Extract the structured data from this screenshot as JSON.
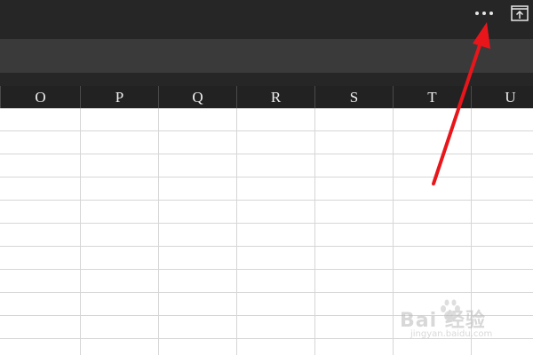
{
  "topbar": {
    "more_icon": "more-horizontal-icon",
    "export_icon": "export-upload-icon"
  },
  "sheet": {
    "columns": [
      "O",
      "P",
      "Q",
      "R",
      "S",
      "T",
      "U"
    ],
    "visible_row_count": 11
  },
  "annotation": {
    "arrow_color": "#e8161b",
    "target": "more-options-button"
  },
  "watermark": {
    "main_text": "Bai 经验",
    "sub_text": "jingyan.baidu.com"
  }
}
